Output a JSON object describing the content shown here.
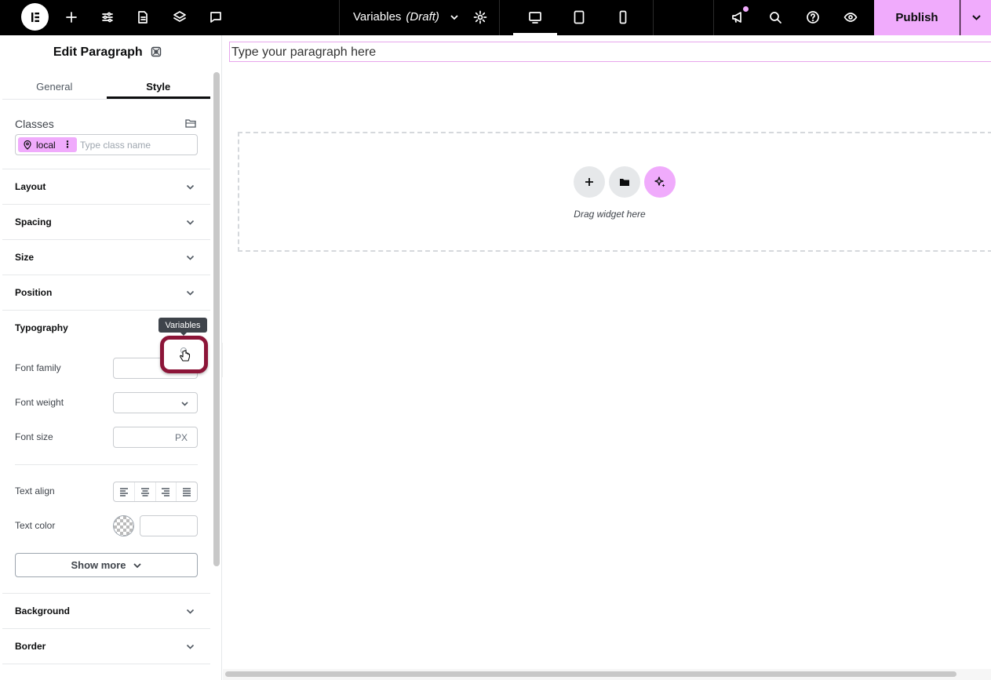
{
  "topbar": {
    "doc_title": "Variables",
    "doc_status": "(Draft)",
    "publish_label": "Publish"
  },
  "panel": {
    "title": "Edit Paragraph",
    "tabs": [
      "General",
      "Style"
    ],
    "active_tab": "Style",
    "classes": {
      "label": "Classes",
      "chip_label": "local",
      "input_placeholder": "Type class name"
    },
    "sections_top": [
      "Layout",
      "Spacing",
      "Size",
      "Position"
    ],
    "typography": {
      "label": "Typography",
      "tooltip": "Variables",
      "font_family_label": "Font family",
      "font_weight_label": "Font weight",
      "font_size_label": "Font size",
      "font_size_unit": "PX",
      "text_align_label": "Text align",
      "text_color_label": "Text color",
      "show_more_label": "Show more"
    },
    "sections_bottom": [
      "Background",
      "Border"
    ]
  },
  "canvas": {
    "paragraph_text": "Type your paragraph here",
    "dropzone_text": "Drag widget here"
  },
  "colors": {
    "accent": "#f0abfc",
    "highlight_ring": "#8c1538",
    "topbar_bg": "#000000"
  }
}
